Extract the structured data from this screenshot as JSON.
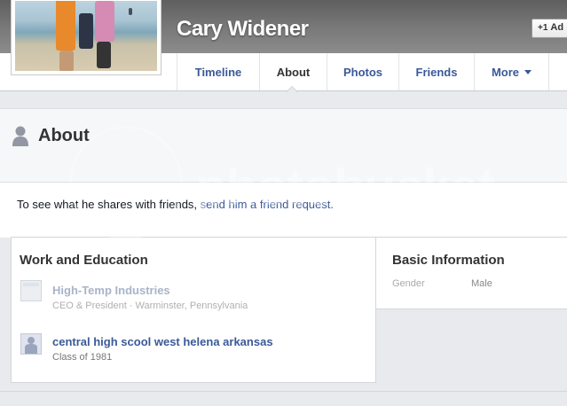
{
  "profile": {
    "name": "Cary Widener",
    "add_friend_label": "Ad"
  },
  "nav": {
    "tabs": [
      {
        "label": "Timeline"
      },
      {
        "label": "About"
      },
      {
        "label": "Photos"
      },
      {
        "label": "Friends"
      },
      {
        "label": "More"
      }
    ],
    "active_tab": "About"
  },
  "about": {
    "title": "About",
    "notice_prefix": "To see what he shares with friends, ",
    "notice_link": "send him a friend request."
  },
  "work_education": {
    "title": "Work and Education",
    "entries": [
      {
        "name": "High-Temp Industries",
        "detail": "CEO & President · Warminster, Pennsylvania",
        "icon": "building-icon"
      },
      {
        "name": "central high scool west helena arkansas",
        "detail": "Class of 1981",
        "icon": "school-icon"
      }
    ]
  },
  "basic_info": {
    "title": "Basic Information",
    "fields": [
      {
        "label": "Gender",
        "value": "Male"
      }
    ]
  },
  "watermark": {
    "text": "photobucket"
  },
  "colors": {
    "link": "#3b5998",
    "page_bg": "#e9eaed",
    "cover_dark": "#5f5f5f"
  }
}
